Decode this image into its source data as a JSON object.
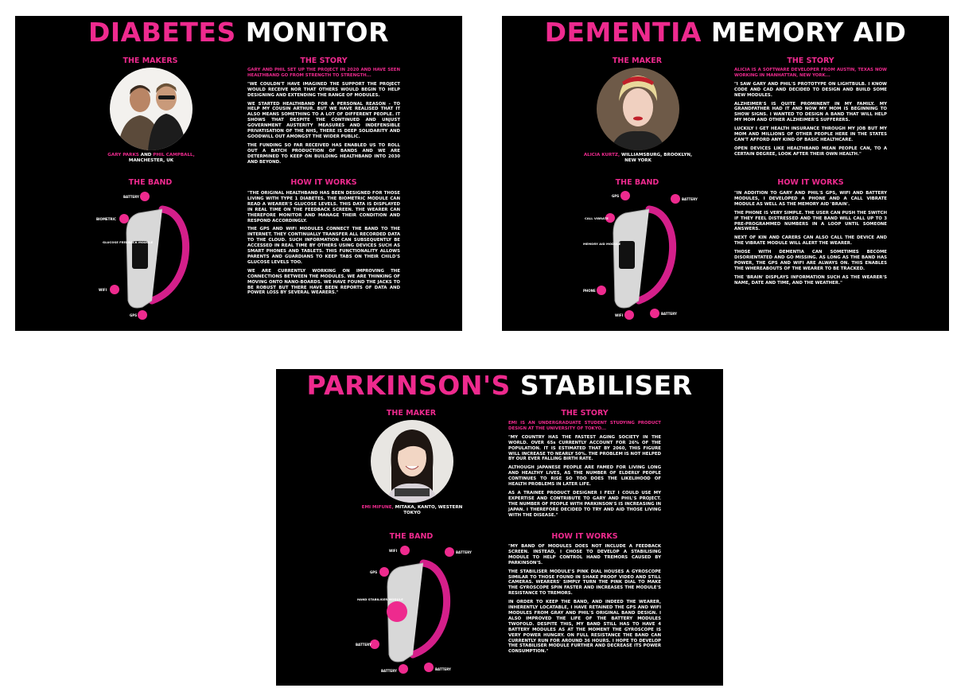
{
  "colors": {
    "accent": "#ee2a8e",
    "panel_bg": "#000000",
    "page_bg": "#ffffff"
  },
  "diabetes": {
    "title_pink": "DIABETES",
    "title_white": "MONITOR",
    "makers_heading": "THE MAKERS",
    "caption_name1": "GARY PARKS",
    "caption_and": "AND",
    "caption_name2": "PHIL CAMPBALL,",
    "caption_place": "MANCHESTER, UK",
    "band_heading": "THE BAND",
    "band_labels": [
      "BATTERY",
      "BIOMETRIC",
      "GLUCOSE FEEDBACK MODULE",
      "WIFI",
      "GPS"
    ],
    "story_heading": "THE STORY",
    "story_intro": "GARY AND PHIL SET UP THE PROJECT IN 2020 AND HAVE SEEN HEALTHBAND GO FROM STRENGTH TO STRENGTH...",
    "story_p1": "\"WE COULDN'T HAVE IMAGINED THE SUPPORT THE PROJECT WOULD RECEIVE NOR THAT OTHERS WOULD BEGIN TO HELP DESIGNING AND EXTENDING THE RANGE OF MODULES.",
    "story_p2": "WE STARTED HEALTHBAND FOR A PERSONAL REASON - TO HELP MY COUSIN ARTHUR. BUT WE HAVE REALISED THAT IT ALSO MEANS SOMETHING TO A LOT OF DIFFERENT PEOPLE. IT SHOWS THAT DESPITE THE CONTINUED AND UNJUST GOVERNMENT AUSTERITY MEASURES AND INDEFENSIBLE PRIVATISATION OF THE NHS, THERE IS DEEP SOLIDARITY AND GOODWILL OUT AMONGST THE WIDER PUBLIC.",
    "story_p3": "THE FUNDING SO FAR RECEIVED HAS ENABLED US TO ROLL OUT A BATCH PRODUCTION OF BANDS AND WE ARE DETERMINED TO KEEP ON BUILDING HEALTHBAND INTO 2030 AND BEYOND.",
    "how_heading": "HOW IT WORKS",
    "how_p1": "\"THE ORIGINAL HEALTHBAND HAS BEEN DESIGNED FOR THOSE LIVING WITH TYPE 1 DIABETES. THE BIOMETRIC MODULE CAN READ A WEARER'S GLUCOSE LEVELS. THIS DATA IS DISPLAYED IN REAL TIME ON THE FEEDBACK SCREEN. THE WEARER CAN THEREFORE MONITOR AND MANAGE THEIR CONDITION AND RESPOND ACCORDINGLY.",
    "how_p2": "THE GPS AND WIFI MODULES CONNECT THE BAND TO THE INTERNET. THEY CONTINUALLY TRANSFER ALL RECORDED DATA TO THE CLOUD. SUCH INFORMATION CAN SUBSEQUENTLY BE ACCESSED IN REAL TIME BY OTHERS USING DEVICES SUCH AS SMART PHONES AND TABLETS. THIS FUNCTIONALITY ALLOWS PARENTS AND GUARDIANS TO KEEP TABS ON THEIR CHILD'S GLUCOSE LEVELS TOO.",
    "how_p3": "WE ARE CURRENTLY WORKING ON IMPROVING THE CONNECTIONS BETWEEN THE MODULES. WE ARE THINKING OF MOVING ONTO NANO-BOARDS. WE HAVE FOUND THE JACKS TO BE ROBUST BUT THERE HAVE BEEN REPORTS OF DATA AND POWER LOSS BY SEVERAL WEARERS.\""
  },
  "dementia": {
    "title_pink": "DEMENTIA",
    "title_white": "MEMORY AID",
    "maker_heading": "THE MAKER",
    "caption_name": "ALICIA KURTZ,",
    "caption_place": "WILLIAMSBURG, BROOKLYN, NEW YORK",
    "band_heading": "THE BAND",
    "band_labels": [
      "GPS",
      "BATTERY",
      "CALL VIBRATE",
      "MEMORY AID MODULE",
      "PHONE",
      "WIFI",
      "BATTERY"
    ],
    "story_heading": "THE STORY",
    "story_intro": "ALICIA IS A SOFTWARE DEVELOPER FROM AUSTIN, TEXAS NOW WORKING IN MANHATTAN, NEW YORK...",
    "story_p1": "\"I SAW GARY AND PHIL'S PROTOTYPE ON LIGHTBULB. I KNOW CODE AND CAD AND DECIDED TO DESIGN AND BUILD SOME NEW MODULES.",
    "story_p2": "ALZHEIMER'S IS QUITE PROMINENT IN MY FAMILY. MY GRANDFATHER HAD IT AND NOW MY MOM IS BEGINNING TO SHOW SIGNS. I WANTED TO DESIGN A BAND THAT WILL HELP MY MOM AND OTHER ALZHEIMER'S SUFFERERS.",
    "story_p3": "LUCKILY I GET HEALTH INSURANCE THROUGH MY JOB BUT MY MOM AND MILLIONS OF OTHER PEOPLE HERE IN THE STATES CAN'T AFFORD ANY KIND OF BASIC HEALTHCARE.",
    "story_p4": "OPEN DEVICES LIKE HEALTHBAND MEAN PEOPLE CAN, TO A CERTAIN DEGREE, LOOK AFTER THEIR OWN HEALTH.\"",
    "how_heading": "HOW IT WORKS",
    "how_p1": "\"IN ADDITION TO GARY AND PHIL'S GPS, WIFI AND BATTERY MODULES, I DEVELOPED A PHONE AND A CALL VIBRATE MODULE AS WELL AS THE MEMORY AID 'BRAIN'.",
    "how_p2": "THE PHONE IS VERY SIMPLE. THE USER CAN PUSH THE SWITCH IF THEY FEEL DISTRESSED AND THE BAND WILL CALL UP TO 3 PRE-PROGRAMMED NUMBERS IN A LOOP UNTIL SOMEONE ANSWERS.",
    "how_p3": "NEXT OF KIN AND CARERS CAN ALSO CALL THE DEVICE AND THE VIBRATE MODULE WILL ALERT THE WEARER.",
    "how_p4": "THOSE WITH DEMENTIA CAN SOMETIMES BECOME DISORIENTATED AND GO MISSING. AS LONG AS THE BAND HAS POWER, THE GPS AND WIFI ARE ALWAYS ON. THIS ENABLES THE WHEREABOUTS OF THE WEARER TO BE TRACKED.",
    "how_p5": "THE 'BRAIN' DISPLAYS INFORMATION SUCH AS THE WEARER'S NAME, DATE AND TIME, AND THE WEATHER.\""
  },
  "parkinsons": {
    "title_pink": "PARKINSON'S",
    "title_white": "STABILISER",
    "maker_heading": "THE MAKER",
    "caption_name": "EMI MIFUNE,",
    "caption_place": "MITAKA, KANTO, WESTERN TOKYO",
    "band_heading": "THE BAND",
    "band_labels": [
      "WIFI",
      "BATTERY",
      "GPS",
      "HAND STABILISER MODULE",
      "BATTERY",
      "BATTERY",
      "BATTERY"
    ],
    "story_heading": "THE STORY",
    "story_intro": "EMI IS AN UNDERGRADUATE STUDENT STUDYING PRODUCT DESIGN AT THE UNIVERSITY OF TOKYO...",
    "story_p1": "\"MY COUNTRY HAS THE FASTEST AGING SOCIETY IN THE WORLD. OVER 65s CURRENTLY ACCOUNT FOR 26% OF THE POPULATION. IT IS ESTIMATED THAT BY 2060, THIS FIGURE WILL INCREASE TO NEARLY 50%. THE PROBLEM IS NOT HELPED BY OUR EVER FALLING BIRTH RATE.",
    "story_p2": "ALTHOUGH JAPANESE PEOPLE ARE FAMED FOR LIVING LONG AND HEALTHY LIVES, AS THE NUMBER OF ELDERLY PEOPLE CONTINUES TO RISE SO TOO DOES THE LIKELIHOOD OF HEALTH PROBLEMS IN LATER LIFE.",
    "story_p3": "AS A TRAINEE PRODUCT DESIGNER I FELT I COULD USE MY EXPERTISE AND CONTRIBUTE TO GARY AND PHIL'S PROJECT. THE NUMBER OF PEOPLE WITH PARKINSON'S IS INCREASING IN JAPAN. I THEREFORE DECIDED TO TRY AND AID THOSE LIVING WITH THE DISEASE.\"",
    "how_heading": "HOW IT WORKS",
    "how_p1": "\"MY BAND OF MODULES DOES NOT INCLUDE A FEEDBACK SCREEN. INSTEAD, I CHOSE TO DEVELOP A STABILISING MODULE TO HELP CONTROL HAND TREMORS CAUSED BY PARKINSON'S.",
    "how_p2": "THE STABILISER MODULE'S PINK DIAL HOUSES A GYROSCOPE SIMILAR TO THOSE FOUND IN SHAKE PROOF VIDEO AND STILL CAMERAS. WEARERS' SIMPLY TURN THE PINK DIAL TO MAKE THE GYROSCOPE SPIN FASTER AND INCREASES THE MODULE'S RESISTANCE TO TREMORS.",
    "how_p3": "IN ORDER TO KEEP THE BAND, AND INDEED THE WEARER, INHERENTLY LOCATABLE, I HAVE RETAINED THE GPS AND WIFI MODULES FROM GRAY AND PHIL'S ORIGINAL BAND DESIGN. I ALSO IMPROVED THE LIFE OF THE BATTERY MODULES TWOFOLD. DESPITE THIS, MY BAND STILL HAS TO HAVE 4 BATTERY MODULES AS AT THE MOMENT THE GYROSCOPE IS VERY POWER HUNGRY. ON FULL RESISTANCE THE BAND CAN CURRENTLY RUN FOR AROUND 36 HOURS. I HOPE TO DEVELOP THE STABILISER MODULE FURTHER AND DECREASE ITS POWER CONSUMPTION.\""
  }
}
